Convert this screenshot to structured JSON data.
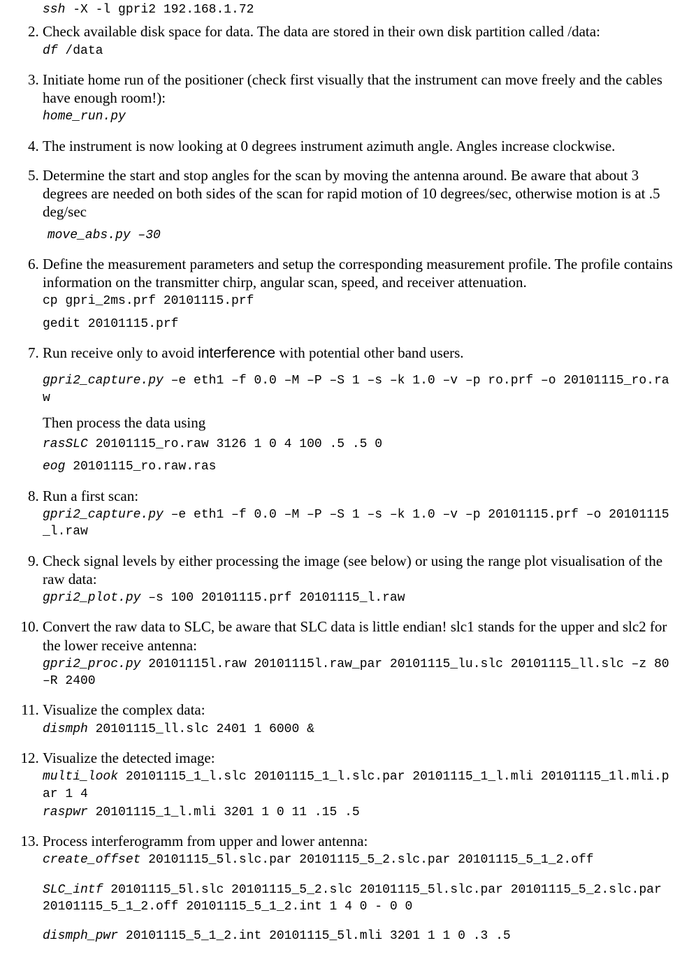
{
  "items": [
    {
      "code_before": "ssh -X -l gpri2 192.168.1.72",
      "code_before_cmd": "ssh"
    },
    {
      "num": "2",
      "text": "Check available disk space for data. The data are stored in their own disk partition called /data:",
      "code1_cmd": "df",
      "code1_rest": " /data"
    },
    {
      "num": "3",
      "text": "Initiate home run of the positioner (check first visually that the instrument can move freely and the cables have enough room!):",
      "code1_cmd": "home_run.py"
    },
    {
      "num": "4",
      "text": "The instrument is now looking at 0 degrees instrument azimuth angle. Angles increase clockwise."
    },
    {
      "num": "5",
      "text": "Determine the start and stop angles for the scan by moving the antenna around. Be aware that about 3 degrees are needed on both sides of the scan for rapid motion of 10 degrees/sec, otherwise motion is at .5 deg/sec",
      "code1_cmd": " move_abs.py –30"
    },
    {
      "num": "6",
      "text": "Define the measurement parameters and setup the corresponding measurement profile. The profile contains information on the transmitter chirp, angular scan, speed, and receiver attenuation.",
      "code1": "cp gpri_2ms.prf 20101115.prf",
      "code2": "gedit 20101115.prf"
    },
    {
      "num": "7",
      "text_before": "Run  receive only to avoid ",
      "text_special": "interference",
      "text_after": " with potential other band users.",
      "code1_cmd": "gpri2_capture.py",
      "code1_rest": " –e eth1 –f 0.0 –M –P –S 1 –s –k 1.0 –v –p ro.prf –o 20101115_ro.raw",
      "subtext": "Then process the data using",
      "code2_cmd": "rasSLC",
      "code2_rest": " 20101115_ro.raw 3126 1 0 4 100 .5 .5 0",
      "code3_cmd": "eog",
      "code3_rest": " 20101115_ro.raw.ras"
    },
    {
      "num": "8",
      "text": "Run a first scan:",
      "code1_cmd": "gpri2_capture.py",
      "code1_rest": " –e eth1 –f 0.0 –M –P –S 1 –s –k 1.0 –v –p 20101115.prf –o 20101115_l.raw"
    },
    {
      "num": "9",
      "text": "Check signal levels by either processing the image (see below) or using the range plot visualisation of the raw data:",
      "code1_cmd": "gpri2_plot.py",
      "code1_rest": " –s 100 20101115.prf 20101115_l.raw"
    },
    {
      "num": "10",
      "text": "Convert the raw data to SLC, be aware that SLC data is little endian! slc1 stands for the upper and slc2 for the lower receive antenna:",
      "code1_cmd": "gpri2_proc.py",
      "code1_rest": " 20101115l.raw 20101115l.raw_par 20101115_lu.slc 20101115_ll.slc –z 80 –R 2400"
    },
    {
      "num": "11",
      "text": "Visualize the complex data:",
      "code1_cmd": "dismph",
      "code1_rest": " 20101115_ll.slc 2401 1 6000 &"
    },
    {
      "num": "12",
      "text": "Visualize the detected image:",
      "code1_cmd": "multi_look",
      "code1_rest": " 20101115_1_l.slc 20101115_1_l.slc.par 20101115_1_l.mli 20101115_1l.mli.par 1 4",
      "code2_cmd": "raspwr",
      "code2_rest": " 20101115_1_l.mli 3201 1 0 11 .15 .5"
    },
    {
      "num": "13",
      "text": "Process interferogramm from upper and lower antenna:",
      "code1_cmd": "create_offset",
      "code1_rest": " 20101115_5l.slc.par 20101115_5_2.slc.par 20101115_5_1_2.off",
      "code2_cmd": "SLC_intf",
      "code2_rest": " 20101115_5l.slc 20101115_5_2.slc 20101115_5l.slc.par 20101115_5_2.slc.par 20101115_5_1_2.off 20101115_5_1_2.int 1 4 0 - 0 0",
      "code3_cmd": "dismph_pwr",
      "code3_rest": " 20101115_5_1_2.int 20101115_5l.mli 3201 1 1 0 .3 .5"
    }
  ]
}
